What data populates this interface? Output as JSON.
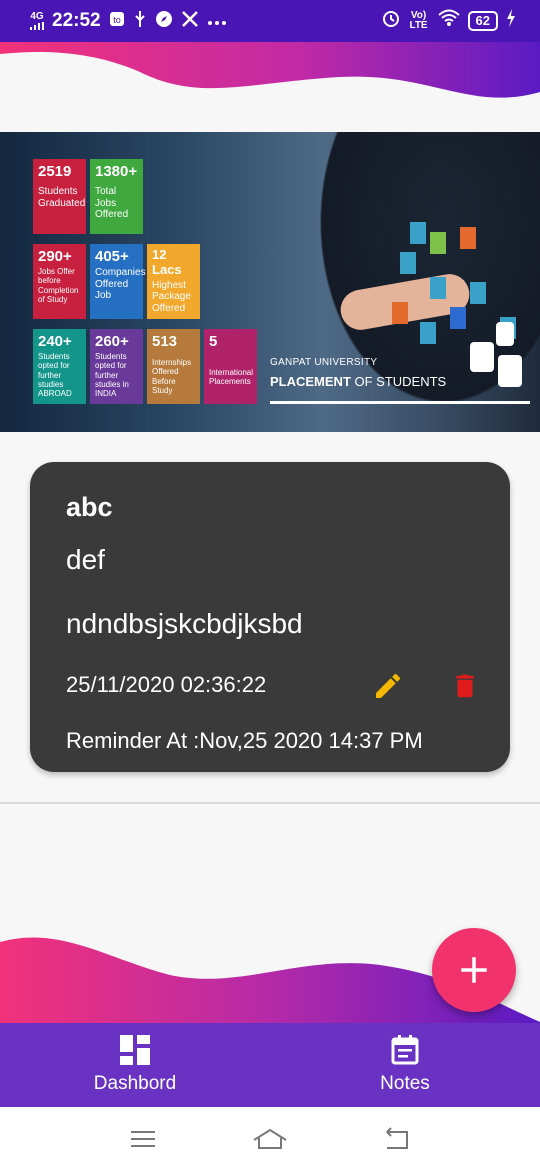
{
  "status_bar": {
    "network": "4G",
    "time": "22:52",
    "volte_label": "Vo) LTE",
    "battery": "62"
  },
  "banner": {
    "tiles": [
      {
        "big": "2519",
        "small": "Students Graduated",
        "color": "#c8213f"
      },
      {
        "big": "1380+",
        "small": "Total Jobs Offered",
        "color": "#3fa83f"
      },
      {
        "big": "290+",
        "small": "Jobs Offer before Completion of Study",
        "color": "#c8213f"
      },
      {
        "big": "405+",
        "small": "Companies Offered Job",
        "color": "#2670c4"
      },
      {
        "big": "12 Lacs",
        "small": "Highest Package Offered",
        "color": "#f2a82c"
      },
      {
        "big": "240+",
        "small": "Students opted for further studies ABROAD",
        "color": "#14958a"
      },
      {
        "big": "260+",
        "small": "Students opted for further studies in INDIA",
        "color": "#6a3a9a"
      },
      {
        "big": "513",
        "small": "Internships Offered Before Study",
        "color": "#b57a3c"
      },
      {
        "big": "5",
        "small": "International Placements",
        "color": "#b0236a"
      }
    ],
    "university": "GANPAT UNIVERSITY",
    "placement_bold": "PLACEMENT",
    "placement_rest": " OF STUDENTS"
  },
  "note": {
    "title": "abc",
    "subtitle": "def",
    "body": "ndndbsjskcbdjksbd",
    "created": "25/11/2020 02:36:22",
    "reminder": "Reminder At :Nov,25 2020 14:37 PM"
  },
  "nav": {
    "dashboard_label": "Dashbord",
    "notes_label": "Notes"
  },
  "colors": {
    "status_bar": "#4a15b5",
    "wave_pink": "#f2327a",
    "wave_purple": "#5a1bc4",
    "card_bg": "#3a3a3a",
    "edit_icon": "#f5b700",
    "delete_icon": "#e01b1b",
    "fab": "#f2326c",
    "bottom_nav": "#6a32c3"
  },
  "icons": {
    "edit": "pencil-icon",
    "delete": "trash-icon",
    "fab": "plus-icon",
    "dashboard": "dashboard-grid-icon",
    "notes": "calendar-notes-icon"
  }
}
